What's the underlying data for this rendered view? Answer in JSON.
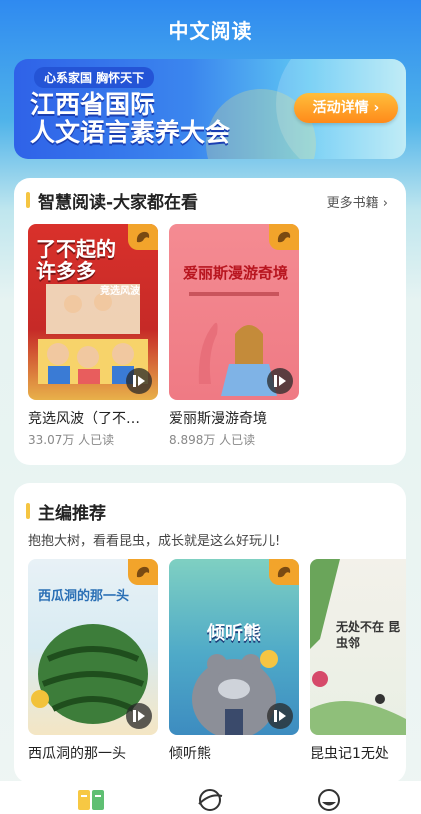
{
  "header": {
    "title": "中文阅读"
  },
  "banner": {
    "slogan": "心系家国 胸怀天下",
    "headline_line1": "江西省国际",
    "headline_line2": "人文语言素养大会",
    "cta_label": "活动详情 ›"
  },
  "section1": {
    "title": "智慧阅读-大家都在看",
    "more_label": "更多书籍 ›",
    "books": [
      {
        "title": "竞选风波（了不…",
        "reads": "33.07万 人已读",
        "cover_text": "了不起的许多多",
        "cover_sub": "竞选风波"
      },
      {
        "title": "爱丽斯漫游奇境",
        "reads": "8.898万 人已读",
        "cover_text": "爱丽斯漫游奇境"
      }
    ]
  },
  "section2": {
    "title": "主编推荐",
    "subtitle": "抱抱大树，看看昆虫，成长就是这么好玩儿!",
    "books": [
      {
        "title": "西瓜洞的那一头",
        "cover_text": "西瓜洞的那一头"
      },
      {
        "title": "倾听熊",
        "cover_text": "倾听熊"
      },
      {
        "title": "昆虫记1无处",
        "cover_text": "无处不在 昆虫邻"
      }
    ]
  },
  "tabbar": {
    "icons": [
      "book-icon",
      "explore-icon",
      "profile-icon"
    ]
  },
  "colors": {
    "accent": "#f5c542",
    "cta": "#ff8a1a",
    "badge": "#f2a42b"
  }
}
